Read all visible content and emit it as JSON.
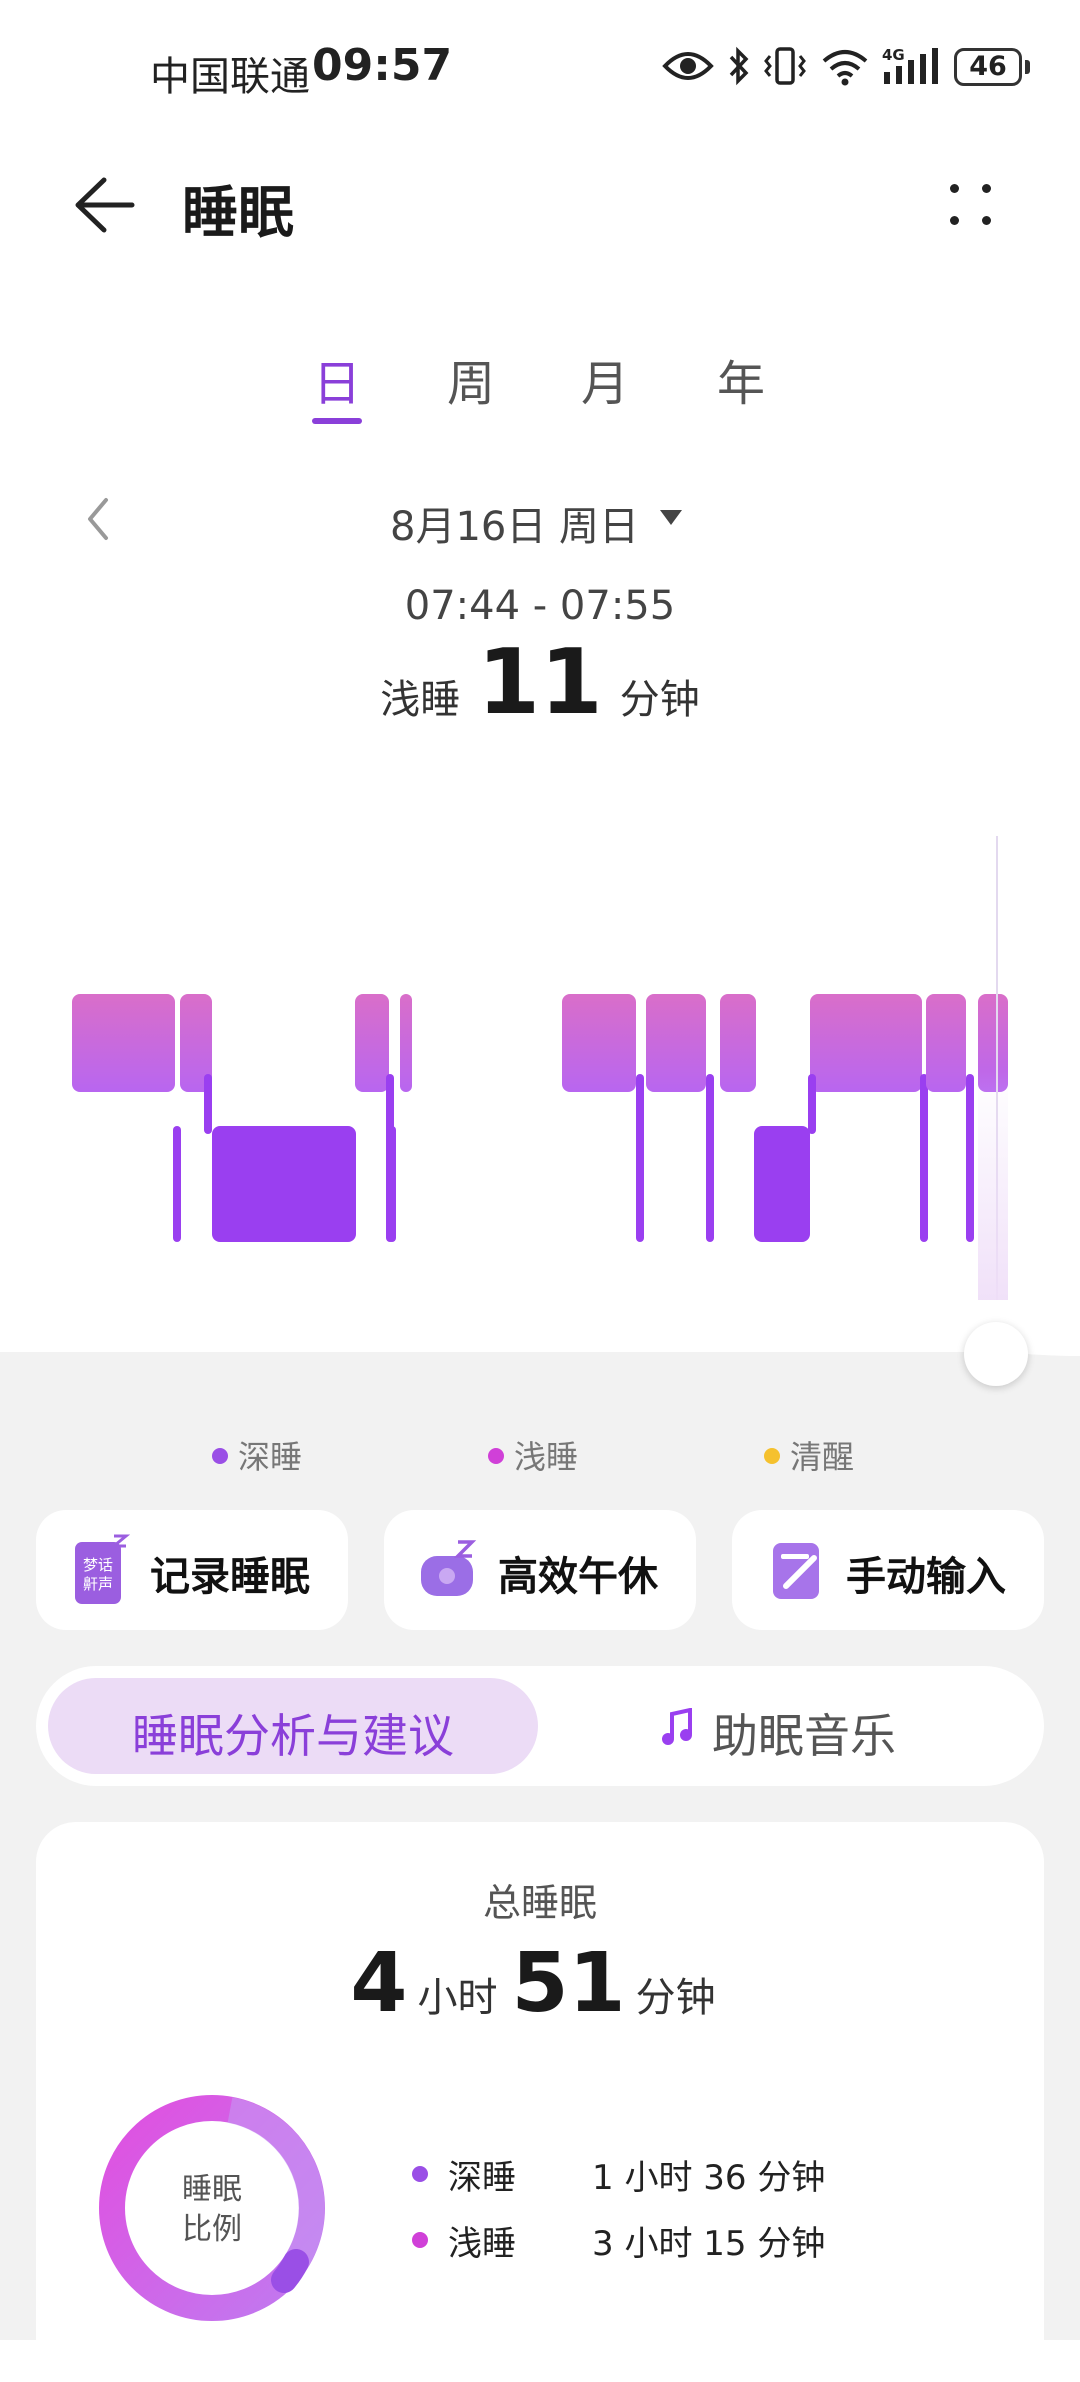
{
  "status_bar": {
    "carrier": "中国联通",
    "time": "09:57",
    "battery": "46"
  },
  "header": {
    "title": "睡眠"
  },
  "tabs": [
    {
      "label": "日"
    },
    {
      "label": "周"
    },
    {
      "label": "月"
    },
    {
      "label": "年"
    }
  ],
  "date": {
    "label": "8月16日 周日"
  },
  "selection": {
    "time_range": "07:44 - 07:55",
    "stage": "浅睡",
    "minutes": "11",
    "unit": "分钟"
  },
  "legend": [
    {
      "label": "深睡",
      "color": "#9a4fe6"
    },
    {
      "label": "浅睡",
      "color": "#d040d8"
    },
    {
      "label": "清醒",
      "color": "#f5c12e"
    }
  ],
  "actions": [
    {
      "label": "记录睡眠",
      "icon": "dream-talk-icon",
      "icon_text_1": "梦话",
      "icon_text_2": "鼾声"
    },
    {
      "label": "高效午休",
      "icon": "nap-pillow-icon"
    },
    {
      "label": "手动输入",
      "icon": "manual-input-icon"
    }
  ],
  "segments": {
    "analysis": "睡眠分析与建议",
    "music": "助眠音乐"
  },
  "summary": {
    "title": "总睡眠",
    "hours": "4",
    "hours_unit": "小时",
    "minutes": "51",
    "minutes_unit": "分钟",
    "ring_label_1": "睡眠",
    "ring_label_2": "比例",
    "rows": [
      {
        "name": "深睡",
        "value": "1 小时 36 分钟",
        "color": "#9a4fe6"
      },
      {
        "name": "浅睡",
        "value": "3 小时 15 分钟",
        "color": "#d040d8"
      }
    ]
  },
  "colors": {
    "accent": "#8a3fd9",
    "light_sleep": "#c46ae6",
    "deep_sleep": "#9a3ff0"
  }
}
